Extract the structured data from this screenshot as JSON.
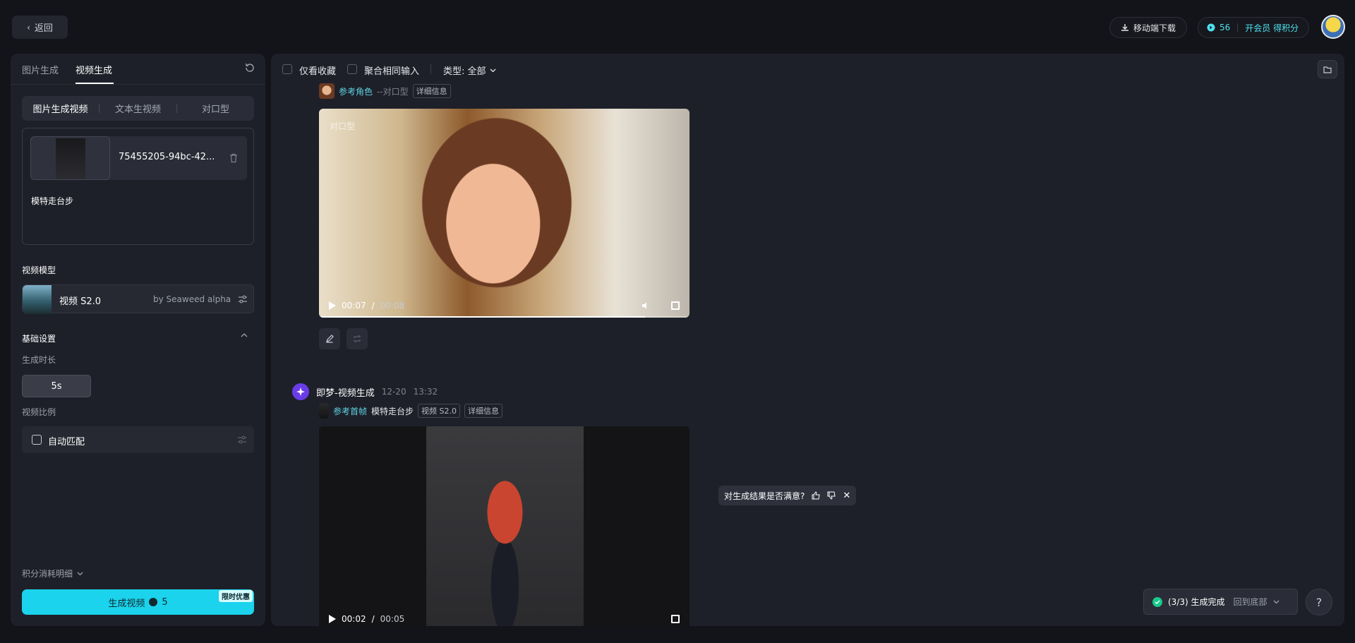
{
  "topbar": {
    "back_label": "返回",
    "download_label": "移动端下载",
    "credits": "56",
    "vip_label": "开会员 得积分"
  },
  "left": {
    "tabs": [
      "图片生成",
      "视频生成"
    ],
    "segments": [
      "图片生成视频",
      "文本生视频",
      "对口型"
    ],
    "file_name": "75455205-94bc-42...",
    "prompt": "模特走台步",
    "model_section": "视频模型",
    "model_name": "视频 S2.0",
    "model_by": "by Seaweed alpha",
    "basic_settings": "基础设置",
    "duration_label": "生成时长",
    "duration_value": "5s",
    "ratio_label": "视频比例",
    "ratio_value": "自动匹配",
    "cost_detail": "积分消耗明细",
    "generate_label": "生成视频",
    "generate_cost": "5",
    "promo": "限时优惠"
  },
  "main": {
    "filter_fav": "仅看收藏",
    "filter_merge": "聚合相同输入",
    "filter_type": "类型: 全部",
    "item1": {
      "ref_tag": "参考角色",
      "ref_sub": "--对口型",
      "detail": "详细信息",
      "video_label": "对口型",
      "time_current": "00:07",
      "time_total": "00:08",
      "progress": 0.88
    },
    "item2": {
      "title": "即梦-视频生成",
      "date": "12-20",
      "time": "13:32",
      "ref_tag": "参考首帧",
      "prompt": "模特走台步",
      "model_chip": "视频 S2.0",
      "detail": "详细信息",
      "feedback": "对生成结果是否满意?",
      "time_current": "00:02",
      "time_total": "00:05"
    }
  },
  "toast": {
    "status": "(3/3) 生成完成",
    "to_bottom": "回到底部"
  },
  "help": "?"
}
